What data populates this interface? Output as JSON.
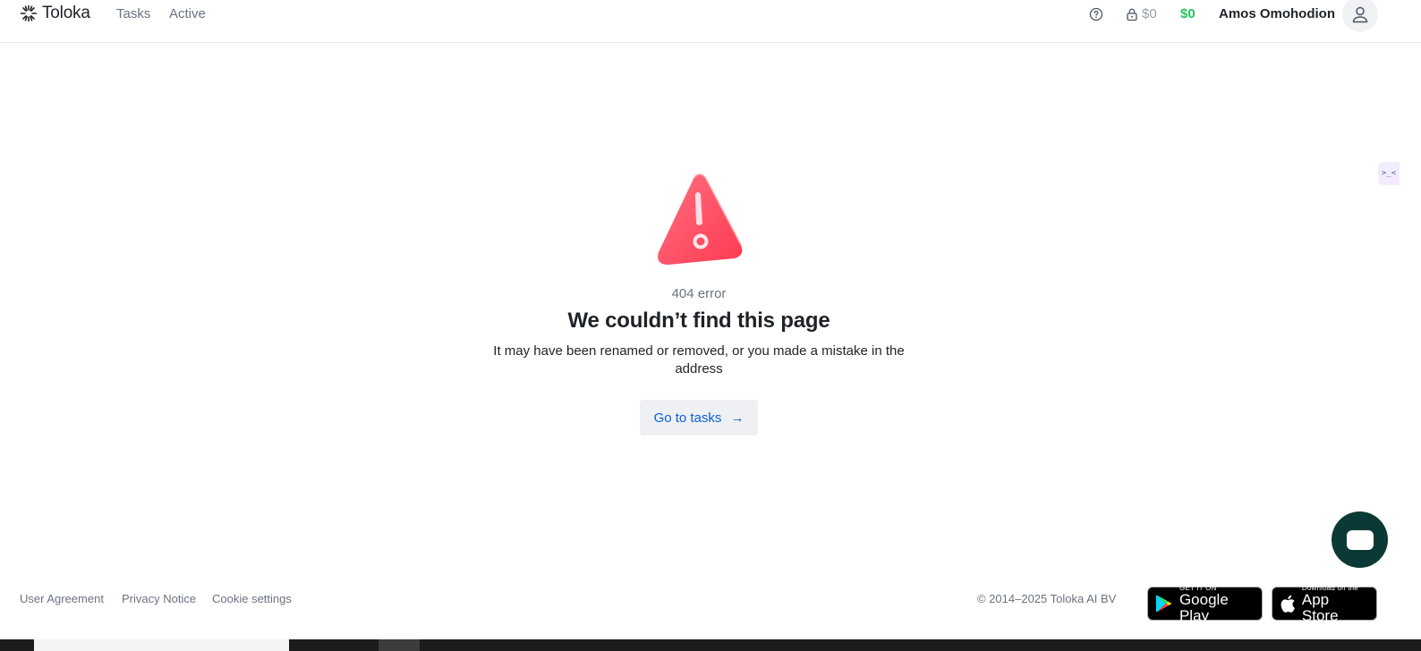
{
  "header": {
    "brand": "Toloka",
    "nav": [
      {
        "label": "Tasks"
      },
      {
        "label": "Active"
      }
    ],
    "locked_balance": "$0",
    "balance": "$0",
    "user_name": "Amos Omohodion"
  },
  "side_widget": {
    "text": ">_<"
  },
  "error": {
    "code": "404 error",
    "title": "We couldn’t find this page",
    "description": "It may have been renamed or removed, or you made a mistake in the address",
    "button_label": "Go to tasks",
    "button_arrow": "→"
  },
  "footer": {
    "links": [
      {
        "label": "User Agreement"
      },
      {
        "label": "Privacy Notice"
      },
      {
        "label": "Cookie settings"
      }
    ],
    "copyright": "© 2014–2025 Toloka AI BV",
    "google_play": {
      "small": "GET IT ON",
      "big": "Google Play"
    },
    "app_store": {
      "small": "Download on the",
      "big": "App Store"
    }
  },
  "colors": {
    "accent": "#0b5fd7",
    "balance": "#22c55e",
    "warning": "#ff4d63",
    "chat": "#0b3a36"
  }
}
